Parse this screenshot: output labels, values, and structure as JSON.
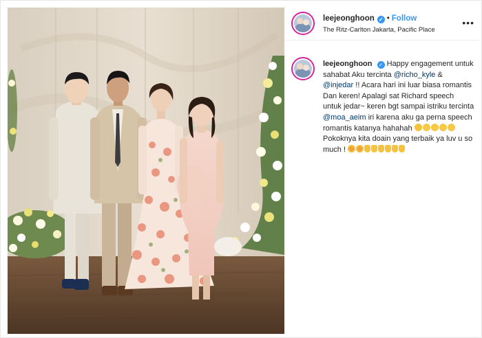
{
  "header": {
    "username": "leejeonghoon",
    "follow_label": "Follow",
    "separator": "•",
    "location": "The Ritz-Carlton Jakarta, Pacific Place",
    "more_label": "•••",
    "verified_glyph": "✓"
  },
  "caption": {
    "username": "leejeonghoon",
    "text_1": "Happy engagement untuk sahabat Aku tercinta ",
    "mention_1": "@richo_kyle",
    "text_2": " & ",
    "mention_2": "@injedar",
    "text_3": " !! Acara hari ini luar biasa romantis Dan keren! Apalagi sat Richard speech untuk jedar~ keren bgt sampai istriku tercinta ",
    "mention_3": "@moa_aeim",
    "text_4": " iri karena aku ga perna speech romantis katanya hahahah ",
    "text_5": " Pokoknya kita doain yang terbaik ya luv u so much ! ",
    "emoji_line_1": [
      "grinning",
      "laughing-tears",
      "laughing-tears",
      "laughing-tears",
      "laughing-tears"
    ],
    "emoji_line_2": [
      "heart-eyes",
      "heart-eyes",
      "thumbs-up",
      "thumbs-up",
      "thumbs-up",
      "praying-hands",
      "praying-hands",
      "praying-hands"
    ]
  },
  "colors": {
    "verified": "#3897f0",
    "follow": "#3897f0",
    "mention": "#003569",
    "avatar_ring": "#d6249f"
  },
  "icons": [
    "verified-badge-icon",
    "more-options-icon"
  ]
}
